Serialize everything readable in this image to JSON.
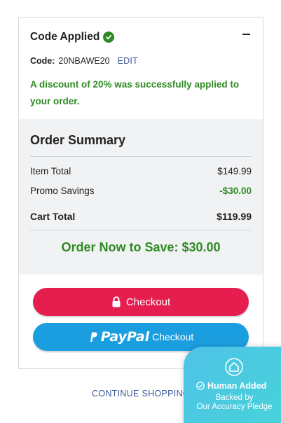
{
  "promo": {
    "title": "Code Applied",
    "code_label": "Code:",
    "code_value": "20NBAWE20",
    "edit_label": "EDIT",
    "message": "A discount of 20% was successfully applied to your order."
  },
  "summary": {
    "title": "Order Summary",
    "item_total_label": "Item Total",
    "item_total_value": "$149.99",
    "promo_label": "Promo Savings",
    "promo_value": "-$30.00",
    "cart_total_label": "Cart Total",
    "cart_total_value": "$119.99",
    "save_message": "Order Now to Save: $30.00"
  },
  "buttons": {
    "checkout_label": "Checkout",
    "paypal_brand": "PayPal",
    "paypal_label": "Checkout"
  },
  "links": {
    "continue_shopping": "CONTINUE SHOPPING"
  },
  "badge": {
    "title": "Human Added",
    "line1": "Backed by",
    "line2": "Our Accuracy Pledge"
  },
  "colors": {
    "success_green": "#2e8b22",
    "checkout_red": "#e61e50",
    "paypal_blue": "#1b9ee0",
    "link_blue": "#3b5998",
    "summary_bg": "#f1f2f4"
  },
  "icons": [
    "check-circle-icon",
    "minus-icon",
    "lock-icon",
    "paypal-icon",
    "home-icon",
    "check-icon"
  ]
}
